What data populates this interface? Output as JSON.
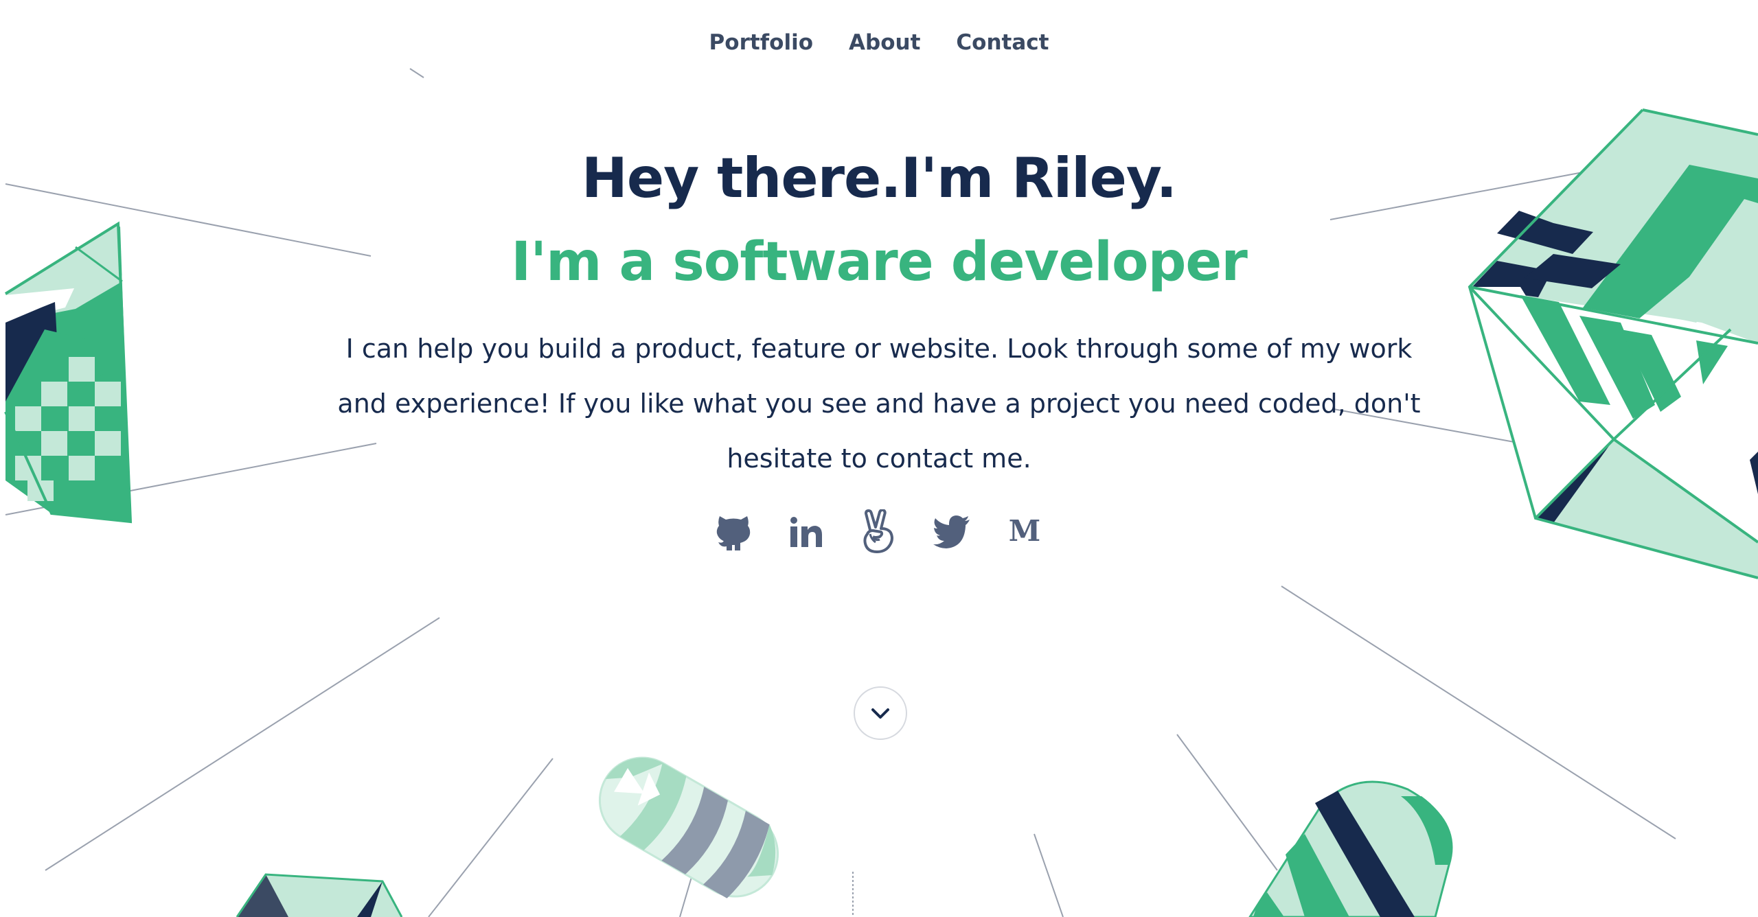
{
  "nav": {
    "items": [
      {
        "label": "Portfolio"
      },
      {
        "label": "About"
      },
      {
        "label": "Contact"
      }
    ]
  },
  "hero": {
    "greeting": "Hey there.I'm Riley.",
    "role": "I'm a software developer",
    "description": "I can help you build a product, feature or website. Look through some of my work and experience! If you like what you see and have a project you need coded, don't hesitate to contact me."
  },
  "socials": [
    {
      "icon": "github-icon"
    },
    {
      "icon": "linkedin-icon"
    },
    {
      "icon": "angellist-icon"
    },
    {
      "icon": "twitter-icon"
    },
    {
      "icon": "medium-icon"
    }
  ],
  "scroll": {
    "icon": "chevron-down-icon"
  },
  "colors": {
    "navy": "#172a4d",
    "green": "#38b47f",
    "light_green": "#c4e8d8",
    "mid_green": "#a6dcc2",
    "slate": "#52607c",
    "gray_blue": "#8e9aab",
    "line_gray": "#9aa1ae"
  }
}
